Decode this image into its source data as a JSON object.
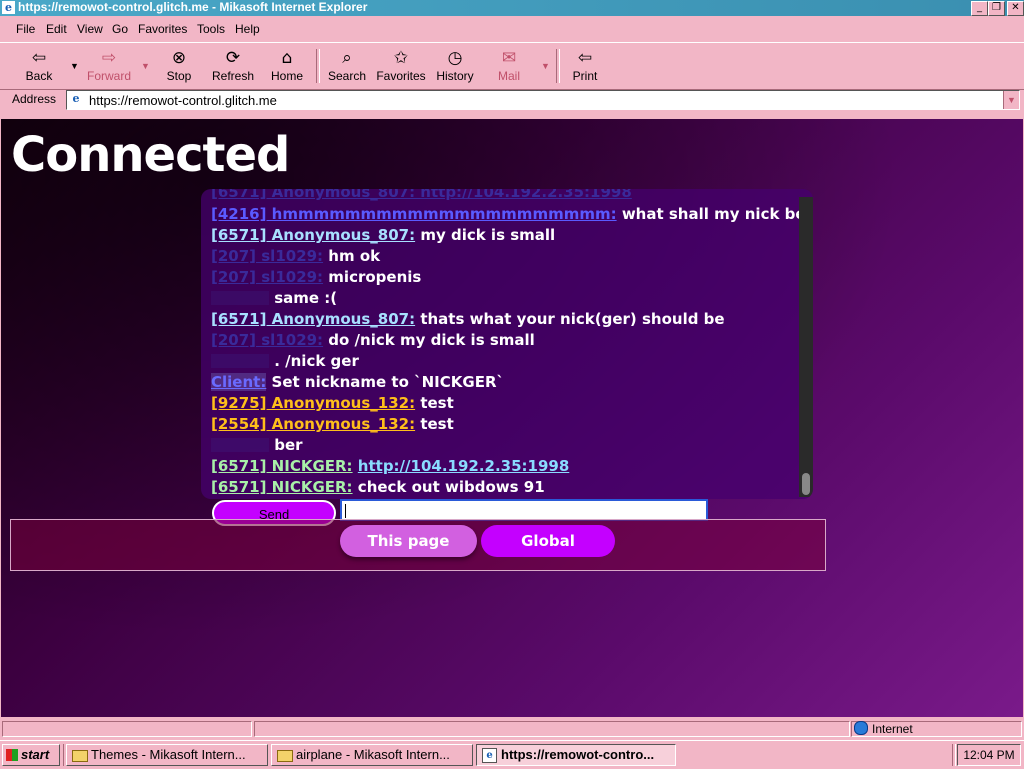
{
  "window": {
    "title": "https://remowot-control.glitch.me - Mikasoft Internet Explorer",
    "icon": "ie-icon"
  },
  "menu": [
    "File",
    "Edit",
    "View",
    "Go",
    "Favorites",
    "Tools",
    "Help"
  ],
  "toolbar": {
    "back": "Back",
    "forward": "Forward",
    "stop": "Stop",
    "refresh": "Refresh",
    "home": "Home",
    "search": "Search",
    "favorites": "Favorites",
    "history": "History",
    "mail": "Mail",
    "print": "Print"
  },
  "address": {
    "label": "Address",
    "value": "https://remowot-control.glitch.me"
  },
  "page": {
    "heading": "Connected",
    "chat": [
      {
        "name": "[4216] hmmmmmmmmmmmmmmmmmmmmm:",
        "msg": "what shall my nick be",
        "style": "c-blue"
      },
      {
        "name": "[6571] Anonymous_807:",
        "msg": "my dick is small",
        "style": "c-cyan"
      },
      {
        "name": "[207] sl1029:",
        "msg": "hm ok",
        "style": "c-faint"
      },
      {
        "name": "[207] sl1029:",
        "msg": "micropenis",
        "style": "c-faint"
      },
      {
        "name": "",
        "msg": "same :(",
        "style": "c-faint",
        "indent": true
      },
      {
        "name": "[6571] Anonymous_807:",
        "msg": "thats what your nick(ger) should be",
        "style": "c-cyan"
      },
      {
        "name": "[207] sl1029:",
        "msg": "do /nick my dick is small",
        "style": "c-faint"
      },
      {
        "name": "",
        "msg": ". /nick ger",
        "style": "c-faint",
        "indent": true
      },
      {
        "name": "Client:",
        "msg": "Set nickname to `NICKGER`",
        "style": "c-client"
      },
      {
        "name": "[9275] Anonymous_132:",
        "msg": "test",
        "style": "c-yellow"
      },
      {
        "name": "[2554] Anonymous_132:",
        "msg": "test",
        "style": "c-yellow"
      },
      {
        "name": "",
        "msg": "ber",
        "style": "c-dkgreen",
        "indent": true
      },
      {
        "name": "[6571] NICKGER:",
        "msg": "http://104.192.2.35:1998",
        "style": "c-green",
        "link": true
      },
      {
        "name": "[6571] NICKGER:",
        "msg": "check out wibdows 91",
        "style": "c-green"
      }
    ],
    "send_label": "Send",
    "input_value": "",
    "tabs": {
      "this_page": "This page",
      "global": "Global"
    }
  },
  "status": {
    "zone": "Internet"
  },
  "taskbar": {
    "start": "start",
    "tasks": [
      "Themes - Mikasoft Intern...",
      "airplane - Mikasoft Intern...",
      "https://remowot-contro..."
    ],
    "clock": "12:04 PM"
  }
}
